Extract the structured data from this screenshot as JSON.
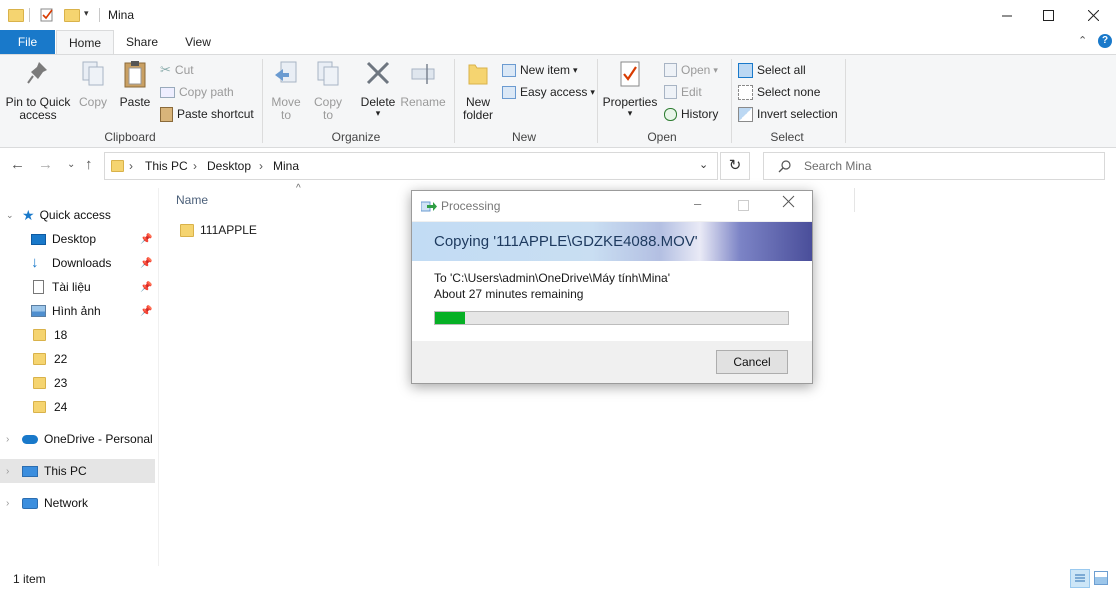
{
  "window": {
    "title": "Mina"
  },
  "ribbon_tabs": [
    {
      "label": "File"
    },
    {
      "label": "Home"
    },
    {
      "label": "Share"
    },
    {
      "label": "View"
    }
  ],
  "ribbon": {
    "clipboard": {
      "label": "Clipboard",
      "pin": "Pin to Quick\naccess",
      "copy": "Copy",
      "paste": "Paste",
      "cut": "Cut",
      "copy_path": "Copy path",
      "paste_shortcut": "Paste shortcut"
    },
    "organize": {
      "label": "Organize",
      "move_to": "Move\nto",
      "copy_to": "Copy\nto",
      "delete": "Delete",
      "rename": "Rename"
    },
    "new": {
      "label": "New",
      "new_folder": "New\nfolder",
      "new_item": "New item",
      "easy_access": "Easy access"
    },
    "open": {
      "label": "Open",
      "properties": "Properties",
      "open": "Open",
      "edit": "Edit",
      "history": "History"
    },
    "select": {
      "label": "Select",
      "select_all": "Select all",
      "select_none": "Select none",
      "invert_selection": "Invert selection"
    }
  },
  "address": {
    "crumbs": [
      "This PC",
      "Desktop",
      "Mina"
    ]
  },
  "search": {
    "placeholder": "Search Mina"
  },
  "sidebar": {
    "quick_access": "Quick access",
    "items": [
      {
        "label": "Desktop",
        "icon": "desktop-icon",
        "pinned": true
      },
      {
        "label": "Downloads",
        "icon": "download-icon",
        "pinned": true
      },
      {
        "label": "Tài liệu",
        "icon": "document-icon",
        "pinned": true
      },
      {
        "label": "Hình ảnh",
        "icon": "pictures-icon",
        "pinned": true
      },
      {
        "label": "18",
        "icon": "folder-icon",
        "pinned": false
      },
      {
        "label": "22",
        "icon": "folder-icon",
        "pinned": false
      },
      {
        "label": "23",
        "icon": "folder-icon",
        "pinned": false
      },
      {
        "label": "24",
        "icon": "folder-icon",
        "pinned": false
      }
    ],
    "onedrive": "OneDrive - Personal",
    "this_pc": "This PC",
    "network": "Network"
  },
  "content": {
    "column_name": "Name",
    "files": [
      {
        "name": "111APPLE"
      }
    ]
  },
  "status": {
    "count": "1 item"
  },
  "dialog": {
    "title": "Processing",
    "heading": "Copying '111APPLE\\GDZKE4088.MOV'",
    "destination": "To 'C:\\Users\\admin\\OneDrive\\Máy tính\\Mina'",
    "remaining": "About 27 minutes remaining",
    "progress_fraction": 0.085,
    "cancel": "Cancel"
  },
  "colors": {
    "accent": "#1979ca",
    "progress": "#06b025",
    "folder": "#f5d470",
    "selection": "#e5e5e5"
  }
}
